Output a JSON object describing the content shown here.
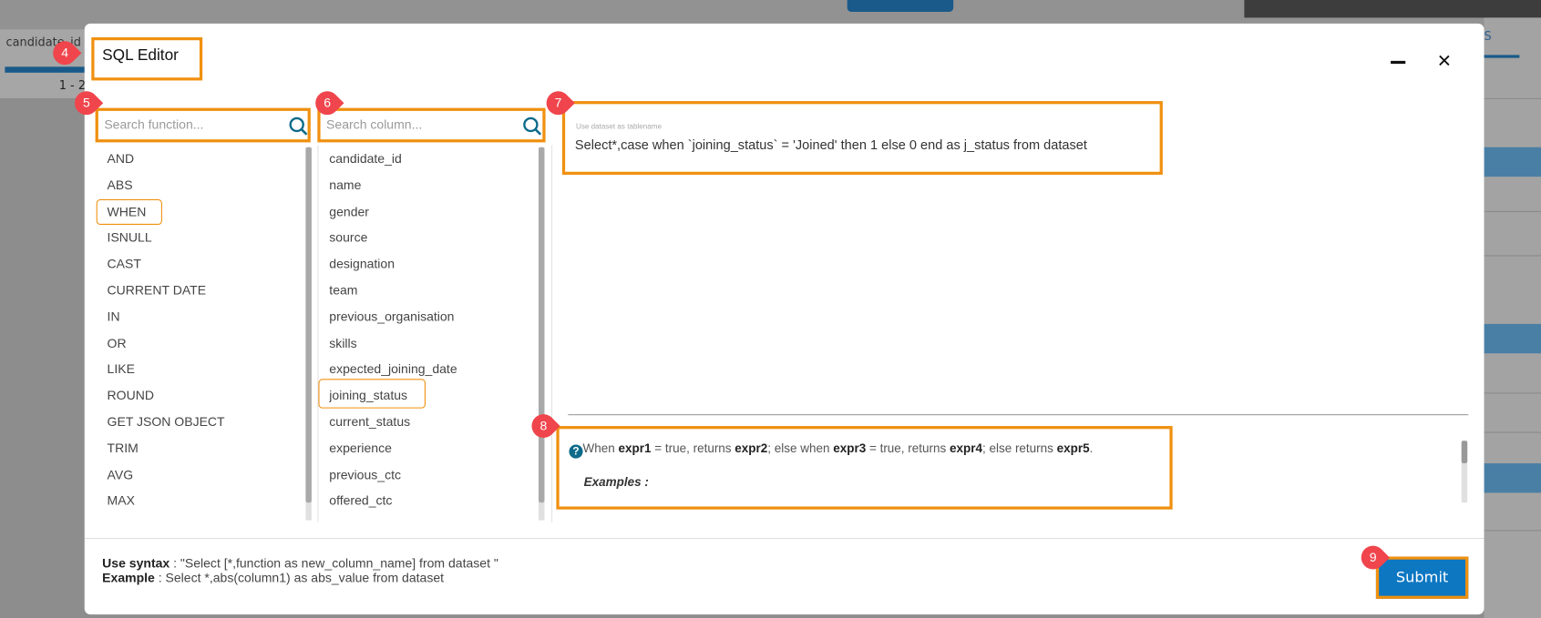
{
  "background": {
    "column_header": "candidate_id",
    "pagination": "1 - 2",
    "tab_fragment": "S"
  },
  "modal": {
    "title": "SQL Editor",
    "minimize_icon": "minus-icon",
    "close_icon": "close-icon",
    "function_search": {
      "placeholder": "Search function...",
      "value": ""
    },
    "column_search": {
      "placeholder": "Search column...",
      "value": ""
    },
    "functions": [
      "AND",
      "ABS",
      "WHEN",
      "ISNULL",
      "CAST",
      "CURRENT DATE",
      "IN",
      "OR",
      "LIKE",
      "ROUND",
      "GET JSON OBJECT",
      "TRIM",
      "AVG",
      "MAX"
    ],
    "selected_function": "WHEN",
    "columns": [
      "candidate_id",
      "name",
      "gender",
      "source",
      "designation",
      "team",
      "previous_organisation",
      "skills",
      "expected_joining_date",
      "joining_status",
      "current_status",
      "experience",
      "previous_ctc",
      "offered_ctc"
    ],
    "selected_column": "joining_status",
    "query": {
      "label": "Use dataset as tablename",
      "value": "Select*,case when `joining_status` = 'Joined' then 1 else 0 end as j_status from dataset"
    },
    "help": {
      "parts": [
        {
          "t": "When ",
          "b": false
        },
        {
          "t": "expr1",
          "b": true
        },
        {
          "t": " = true, returns ",
          "b": false
        },
        {
          "t": "expr2",
          "b": true
        },
        {
          "t": "; else when ",
          "b": false
        },
        {
          "t": "expr3",
          "b": true
        },
        {
          "t": " = true, returns ",
          "b": false
        },
        {
          "t": "expr4",
          "b": true
        },
        {
          "t": "; else returns ",
          "b": false
        },
        {
          "t": "expr5",
          "b": true
        },
        {
          "t": ".",
          "b": false
        }
      ],
      "examples_label": "Examples :"
    },
    "footer": {
      "syntax_label": "Use syntax",
      "syntax_value": " : \"Select [*,function as new_column_name] from dataset \"",
      "example_label": "Example",
      "example_value": " : Select *,abs(column1) as abs_value from dataset"
    },
    "submit_label": "Submit"
  },
  "annotations": [
    "4",
    "5",
    "6",
    "7",
    "8",
    "9"
  ],
  "colors": {
    "accent": "#0d77c2",
    "highlight": "#f0900f",
    "badge": "#f0454c",
    "icon": "#0c6a8a"
  }
}
